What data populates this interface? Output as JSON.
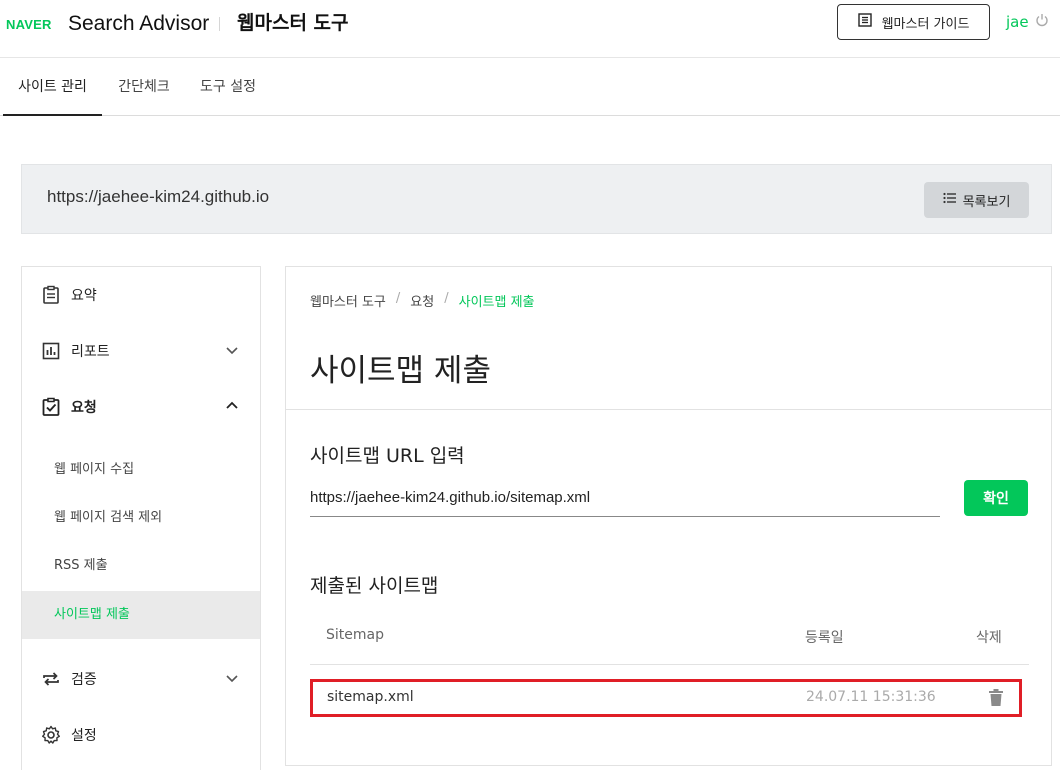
{
  "header": {
    "brand": "NAVER",
    "product": "Search Advisor",
    "tool_title": "웹마스터 도구",
    "guide_button": "웹마스터 가이드",
    "user": "jae",
    "colors": {
      "brand_green": "#03c75a",
      "highlight_red": "#e01e26"
    }
  },
  "tabs": [
    {
      "label": "사이트 관리",
      "active": true
    },
    {
      "label": "간단체크",
      "active": false
    },
    {
      "label": "도구 설정",
      "active": false
    }
  ],
  "site": {
    "url": "https://jaehee-kim24.github.io",
    "list_button": "목록보기"
  },
  "sidebar": {
    "items": [
      {
        "label": "요약",
        "icon": "clipboard-icon"
      },
      {
        "label": "리포트",
        "icon": "bar-chart-icon",
        "expanded": false
      },
      {
        "label": "요청",
        "icon": "clipboard-check-icon",
        "expanded": true
      },
      {
        "label": "검증",
        "icon": "repeat-icon",
        "expanded": false
      },
      {
        "label": "설정",
        "icon": "gear-icon"
      }
    ],
    "sub_items": [
      {
        "label": "웹 페이지 수집",
        "active": false
      },
      {
        "label": "웹 페이지 검색 제외",
        "active": false
      },
      {
        "label": "RSS 제출",
        "active": false
      },
      {
        "label": "사이트맵 제출",
        "active": true
      }
    ]
  },
  "main": {
    "breadcrumb": [
      "웹마스터 도구",
      "요청",
      "사이트맵 제출"
    ],
    "title": "사이트맵 제출",
    "input_section": {
      "title": "사이트맵 URL 입력",
      "value": "https://jaehee-kim24.github.io/sitemap.xml",
      "confirm_button": "확인"
    },
    "submitted_section": {
      "title": "제출된 사이트맵",
      "columns": [
        "Sitemap",
        "등록일",
        "삭제"
      ],
      "rows": [
        {
          "sitemap": "sitemap.xml",
          "date": "24.07.11 15:31:36"
        }
      ]
    }
  }
}
